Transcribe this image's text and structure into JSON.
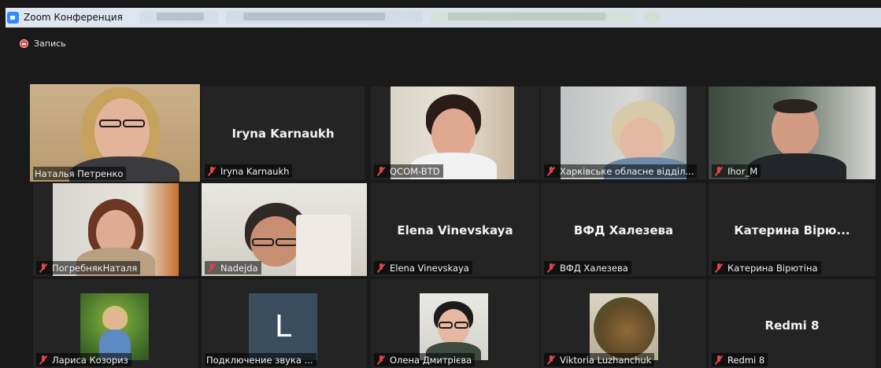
{
  "window": {
    "app_title": "Zoom Конференция",
    "app_icon": "zoom-camera-icon"
  },
  "recording": {
    "label": "Запись",
    "icon": "record-icon",
    "color": "#e24b4b"
  },
  "colors": {
    "active_speaker_border": "#c9dc6c",
    "mute_icon": "#e14545",
    "tile_bg": "#242424",
    "page_bg": "#1a1a1a"
  },
  "participants": [
    {
      "name": "Наталья Петренко",
      "muted": false,
      "video": true,
      "active": true
    },
    {
      "name": "Iryna Karnaukh",
      "display_name": "Iryna Karnaukh",
      "muted": true,
      "video": false
    },
    {
      "name": "QCOM-BTD",
      "muted": true,
      "video": true
    },
    {
      "name": "Харківське обласне відділ...",
      "muted": true,
      "video": true
    },
    {
      "name": "Ihor_M",
      "muted": true,
      "video": true
    },
    {
      "name": "ПогребнякНаталя",
      "muted": true,
      "video": true
    },
    {
      "name": "Nadejda",
      "muted": true,
      "video": true
    },
    {
      "name": "Elena Vinevskaya",
      "display_name": "Elena Vinevskaya",
      "muted": true,
      "video": false
    },
    {
      "name": "ВФД Халезева",
      "display_name": "ВФД Халезева",
      "muted": true,
      "video": false
    },
    {
      "name": "Катерина Вірютіна",
      "display_name": "Катерина Вірю...",
      "muted": true,
      "video": false
    },
    {
      "name": "Лариса Козориз",
      "muted": true,
      "video": true
    },
    {
      "name": "Подключение звука ...",
      "avatar_letter": "L",
      "muted": false,
      "video": false
    },
    {
      "name": "Олена Дмитрієва",
      "muted": true,
      "video": true
    },
    {
      "name": "Viktoria Luzhanchuk",
      "muted": true,
      "video": true
    },
    {
      "name": "Redmi 8",
      "display_name": "Redmi 8",
      "muted": true,
      "video": false
    }
  ]
}
